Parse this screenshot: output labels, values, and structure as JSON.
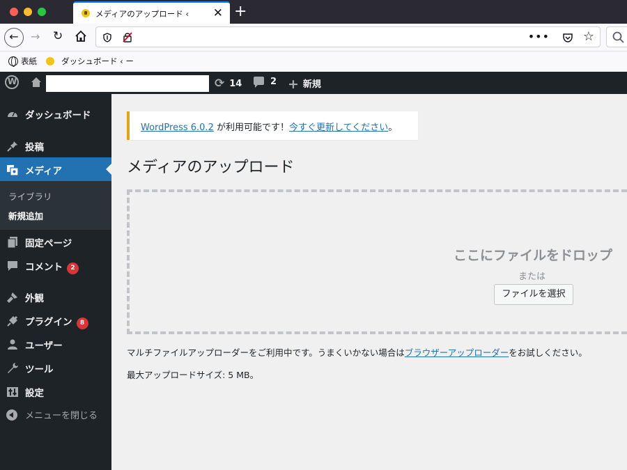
{
  "browser": {
    "tab_title": "メディアのアップロード ‹",
    "tab_close": "✕",
    "new_tab": "+",
    "url_dots": "•••",
    "bookmarks": [
      "表紙",
      "ダッシュボード ‹ ー"
    ]
  },
  "adminbar": {
    "updates_count": "14",
    "comments_count": "2",
    "new_label": "新規"
  },
  "sidebar": {
    "items": [
      {
        "label": "ダッシュボード",
        "icon": "dashboard-icon"
      },
      {
        "label": "投稿",
        "icon": "pin-icon"
      },
      {
        "label": "メディア",
        "icon": "media-icon"
      },
      {
        "label": "固定ページ",
        "icon": "page-icon"
      },
      {
        "label": "コメント",
        "icon": "comment-icon",
        "badge": "2"
      },
      {
        "label": "外観",
        "icon": "brush-icon"
      },
      {
        "label": "プラグイン",
        "icon": "plugin-icon",
        "badge": "8"
      },
      {
        "label": "ユーザー",
        "icon": "user-icon"
      },
      {
        "label": "ツール",
        "icon": "wrench-icon"
      },
      {
        "label": "設定",
        "icon": "settings-icon"
      }
    ],
    "submenu": [
      "ライブラリ",
      "新規追加"
    ],
    "collapse_label": "メニューを閉じる"
  },
  "notice": {
    "version_link": "WordPress 6.0.2",
    "middle_text": " が利用可能です！",
    "update_link": "今すぐ更新してください",
    "end_text": "。"
  },
  "page": {
    "title": "メディアのアップロード",
    "drop_title": "ここにファイルをドロップ",
    "drop_or": "または",
    "select_button": "ファイルを選択",
    "info_prefix": "マルチファイルアップローダーをご利用中です。うまくいかない場合は",
    "info_link": "ブラウザーアップローダー",
    "info_suffix": "をお試しください。",
    "max_size": "最大アップロードサイズ: 5 MB。"
  },
  "colors": {
    "admin_bar": "#1d2327",
    "accent": "#2271b1",
    "notice_border": "#dba617",
    "badge": "#d63638"
  }
}
